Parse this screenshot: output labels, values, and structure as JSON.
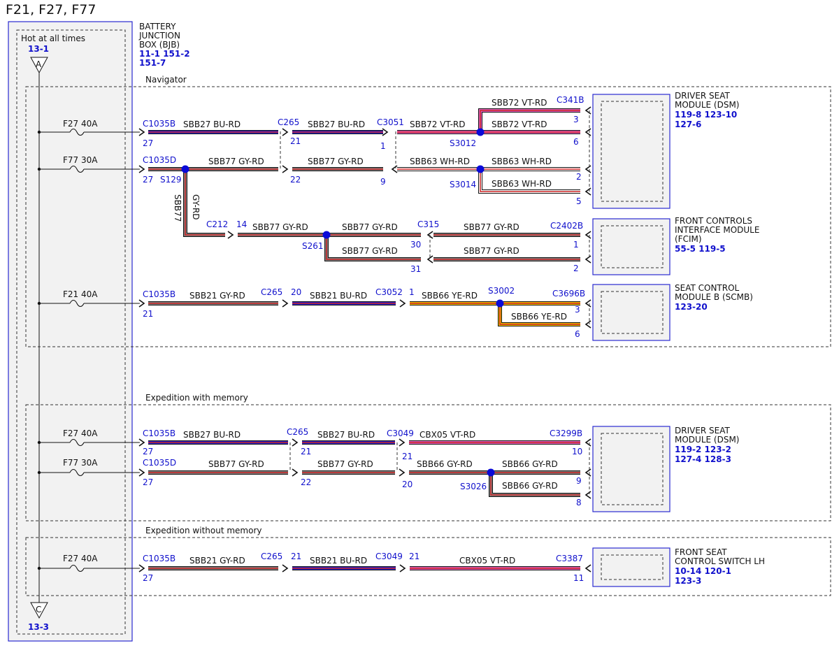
{
  "title": "F21, F27, F77",
  "bjb": {
    "hot_label": "Hot at all times",
    "top_ref": "13-1",
    "top_terminal": "A",
    "bottom_terminal": "C",
    "bottom_ref": "13-3",
    "name_lines": [
      "BATTERY",
      "JUNCTION",
      "BOX (BJB)"
    ],
    "ref_line1": "11-1  151-2",
    "ref_line2": "151-7"
  },
  "sections": {
    "navigator": "Navigator",
    "exp_mem": "Expedition with memory",
    "exp_nomem": "Expedition without memory"
  },
  "fuses": {
    "nav_f27": "F27  40A",
    "nav_f77": "F77  30A",
    "nav_f21": "F21  40A",
    "mem_f27": "F27  40A",
    "mem_f77": "F77  30A",
    "nomem_f27": "F27  40A"
  },
  "modules": {
    "dsm_nav": {
      "lines": [
        "DRIVER SEAT",
        "MODULE (DSM)"
      ],
      "refs": [
        "119-8  123-10",
        "127-6"
      ]
    },
    "fcim": {
      "lines": [
        "FRONT CONTROLS",
        "INTERFACE MODULE",
        "(FCIM)"
      ],
      "refs": [
        "55-5  119-5"
      ]
    },
    "scmb": {
      "lines": [
        "SEAT CONTROL",
        "MODULE B (SCMB)"
      ],
      "refs": [
        "123-20"
      ]
    },
    "dsm_mem": {
      "lines": [
        "DRIVER SEAT",
        "MODULE (DSM)"
      ],
      "refs": [
        "119-2 123-2",
        "127-4 128-3"
      ]
    },
    "fscs": {
      "lines": [
        "FRONT SEAT",
        "CONTROL SWITCH LH"
      ],
      "refs": [
        "10-14 120-1",
        "123-3"
      ]
    }
  },
  "connectors": {
    "c1035b_1": "C1035B",
    "c1035b_1_pin": "27",
    "c265_1": "C265",
    "c265_1_pin": "21",
    "c3051": "C3051",
    "c3051_pin": "1",
    "c341b": "C341B",
    "c341b_pin3": "3",
    "c341b_pin6": "6",
    "c1035d_1": "C1035D",
    "c1035d_1_pin": "27",
    "c265_2_pin": "22",
    "c3051_pin9": "9",
    "dsm_pin2": "2",
    "dsm_pin5": "5",
    "c212": "C212",
    "c212_pin": "14",
    "c315": "C315",
    "c315_pin30": "30",
    "c315_pin31": "31",
    "c2402b": "C2402B",
    "c2402b_pin1": "1",
    "c2402b_pin2": "2",
    "c1035b_2": "C1035B",
    "c1035b_2_pin": "21",
    "c265_3": "C265",
    "c265_3_pin": "20",
    "c3052": "C3052",
    "c3052_pin": "1",
    "c3696b": "C3696B",
    "c3696b_pin3": "3",
    "c3696b_pin6": "6",
    "m_c1035b": "C1035B",
    "m_c1035b_pin": "27",
    "m_c265": "C265",
    "m_c265_pin21": "21",
    "m_c265_pin22": "22",
    "m_c3049": "C3049",
    "m_c3049_pin21": "21",
    "m_c3049_pin20": "20",
    "m_c3299b": "C3299B",
    "m_c3299b_pin10": "10",
    "m_c3299b_pin9": "9",
    "m_c3299b_pin8": "8",
    "m_c1035d": "C1035D",
    "m_c1035d_pin": "27",
    "n_c1035b": "C1035B",
    "n_c1035b_pin": "27",
    "n_c265": "C265",
    "n_c265_pin": "21",
    "n_c3049": "C3049",
    "n_c3049_pin": "21",
    "n_c3387": "C3387",
    "n_c3387_pin": "11"
  },
  "splices": {
    "s3012": "S3012",
    "s129": "S129",
    "s3014": "S3014",
    "s261": "S261",
    "s3002": "S3002",
    "s3026": "S3026"
  },
  "wires": {
    "w1a": "SBB27  BU-RD",
    "w1b": "SBB27  BU-RD",
    "w1c": "SBB72  VT-RD",
    "w1d": "SBB72  VT-RD",
    "w1e": "SBB72  VT-RD",
    "w2a": "SBB77  GY-RD",
    "w2b": "SBB77  GY-RD",
    "w2c": "SBB63  WH-RD",
    "w2d": "SBB63  WH-RD",
    "w2e": "SBB63  WH-RD",
    "w3v1": "SBB77",
    "w3v2": "GY-RD",
    "w3a": "SBB77  GY-RD",
    "w3b": "SBB77  GY-RD",
    "w3c": "SBB77  GY-RD",
    "w3d": "SBB77  GY-RD",
    "w3e": "SBB77  GY-RD",
    "w4a": "SBB21  GY-RD",
    "w4b": "SBB21  BU-RD",
    "w4c": "SBB66  YE-RD",
    "w4d": "SBB66  YE-RD",
    "m1a": "SBB27  BU-RD",
    "m1b": "SBB27  BU-RD",
    "m1c": "CBX05  VT-RD",
    "m2a": "SBB77  GY-RD",
    "m2b": "SBB77  GY-RD",
    "m2c": "SBB66  GY-RD",
    "m2d": "SBB66  GY-RD",
    "m2e": "SBB66  GY-RD",
    "n1a": "SBB21  GY-RD",
    "n1b": "SBB21  BU-RD",
    "n1c": "CBX05  VT-RD"
  },
  "colors": {
    "connector_text": "#1010cc",
    "gy": "#808080",
    "rd": "#cc2222",
    "bu": "#2020cc",
    "vt": "#e060c0",
    "wh": "#ffffff",
    "ye": "#f0c000",
    "splice": "#0a0ad8"
  }
}
